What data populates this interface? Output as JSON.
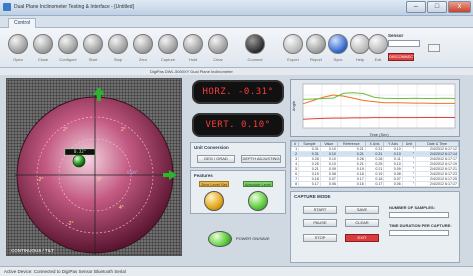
{
  "window": {
    "title": "Dual Plane Inclinometer Testing & Interface - [Untitled]",
    "min_label": "–",
    "max_label": "□",
    "close_label": "x"
  },
  "tabs": [
    {
      "label": "Control"
    }
  ],
  "toolbar": {
    "buttons": [
      {
        "label": "Open",
        "icon": "power-icon"
      },
      {
        "label": "Close",
        "icon": "power-icon"
      },
      {
        "label": "Configure",
        "icon": "settings-icon"
      },
      {
        "label": "Start",
        "icon": "play-icon"
      },
      {
        "label": "Stop",
        "icon": "stop-icon"
      },
      {
        "label": "Zero",
        "icon": "zero-icon"
      },
      {
        "label": "Capture",
        "icon": "capture-icon"
      },
      {
        "label": "Hold",
        "icon": "hold-icon"
      },
      {
        "label": "Clear",
        "icon": "clear-icon"
      },
      {
        "label": "Connect",
        "icon": "connect-icon"
      },
      {
        "label": "Export",
        "icon": "export-icon"
      },
      {
        "label": "Report",
        "icon": "report-icon"
      },
      {
        "label": "Sync",
        "icon": "sync-icon"
      },
      {
        "label": "Help",
        "icon": "help-icon"
      },
      {
        "label": "Exit",
        "icon": "exit-icon"
      }
    ],
    "side": {
      "label": "Sensor",
      "red_button": "DISCONNECT"
    }
  },
  "status_line": "DigiPas DWL-5000XY Dual Plane Inclinometer",
  "bubble": {
    "ring_labels": [
      "2°",
      "2°",
      "-2°",
      "-2°",
      "0°",
      "4°"
    ],
    "x_value_label": "0.32°",
    "y_value_label": "0.10°",
    "caption": "CONTINUOUS / TILT"
  },
  "readouts": {
    "horizontal": "HORZ. -0.31°",
    "vertical": "VERT. 0.10°"
  },
  "unit_conversion": {
    "title": "Unit Conversion",
    "buttons": [
      "DEG / GRAD",
      "DEPTH ADJUSTING"
    ]
  },
  "features": {
    "title": "Features",
    "labels": [
      "Zero Level Set",
      "Absolute Level"
    ]
  },
  "toggle": {
    "label": "POWER ON/SAVE"
  },
  "chart_data": {
    "type": "line",
    "title": "",
    "xlabel": "Time (Sec)",
    "ylabel": "Angle",
    "x": [
      0,
      1,
      2,
      3,
      4,
      5,
      6,
      7,
      8,
      9,
      10,
      11,
      12,
      13,
      14,
      15
    ],
    "series": [
      {
        "name": "",
        "color": "#f07020",
        "values": [
          0.1,
          0.25,
          0.4,
          0.5,
          0.45,
          0.35,
          0.25,
          0.2,
          0.15,
          0.15,
          0.14,
          0.13,
          0.13,
          0.12,
          0.12,
          0.12
        ]
      },
      {
        "name": "",
        "color": "#6abf3a",
        "values": [
          0.3,
          0.32,
          0.34,
          0.36,
          0.58,
          0.6,
          0.56,
          0.4,
          0.35,
          0.34,
          0.34,
          0.35,
          0.34,
          0.34,
          0.35,
          0.34
        ]
      },
      {
        "name": "",
        "color": "#e04040",
        "values": [
          -0.6,
          -0.58,
          -0.56,
          -0.55,
          -0.55,
          -0.54,
          -0.54,
          -0.53,
          -0.53,
          -0.53,
          -0.53,
          -0.53,
          -0.52,
          -0.52,
          -0.52,
          -0.52
        ]
      }
    ],
    "ylim": [
      -1,
      1
    ],
    "grid": true
  },
  "table": {
    "headers": [
      "#",
      "Sample",
      "Value",
      "Reference",
      "X Axis",
      "Y Axis",
      "Unit",
      "Date & Time"
    ],
    "rows": [
      [
        "1",
        "0.31",
        "0.10",
        "0.21",
        "0.31",
        "0.10",
        "°",
        "2/4/2012 6:17:12"
      ],
      [
        "2",
        "0.31",
        "0.10",
        "0.21",
        "0.31",
        "0.10",
        "°",
        "2/4/2012 6:17:14"
      ],
      [
        "3",
        "0.28",
        "0.10",
        "0.28",
        "0.28",
        "0.11",
        "°",
        "2/4/2012 6:17:17"
      ],
      [
        "4",
        "0.25",
        "0.10",
        "0.21",
        "0.25",
        "0.10",
        "°",
        "2/4/2012 6:17:19"
      ],
      [
        "5",
        "0.21",
        "0.09",
        "0.19",
        "0.21",
        "0.09",
        "°",
        "2/4/2012 6:17:21"
      ],
      [
        "6",
        "0.19",
        "0.08",
        "0.18",
        "0.19",
        "0.08",
        "°",
        "2/4/2012 6:17:23"
      ],
      [
        "7",
        "0.18",
        "0.07",
        "0.17",
        "0.18",
        "0.07",
        "°",
        "2/4/2012 6:17:25"
      ],
      [
        "8",
        "0.17",
        "0.06",
        "0.16",
        "0.17",
        "0.06",
        "°",
        "2/4/2012 6:17:27"
      ]
    ]
  },
  "capture": {
    "title": "CAPTURE MODE",
    "buttons": [
      "START",
      "SAVE",
      "PAUSE",
      "CLEAR",
      "STOP",
      "EXIT"
    ],
    "samples_label": "NUMBER OF SAMPLES:",
    "duration_label": "TIME DURATION PER CAPTURE:"
  },
  "status_bar": "Active Device: Connected to DigiPas Sensor Bluetooth Serial"
}
